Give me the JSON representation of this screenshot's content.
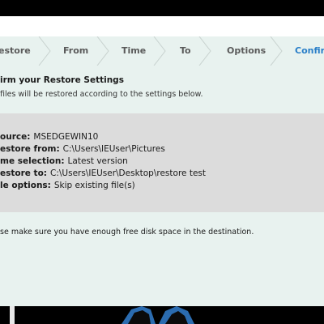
{
  "steps": [
    {
      "label": "estore",
      "active": false
    },
    {
      "label": "From",
      "active": false
    },
    {
      "label": "Time",
      "active": false
    },
    {
      "label": "To",
      "active": false
    },
    {
      "label": "Options",
      "active": false
    },
    {
      "label": "Confirm",
      "active": true
    }
  ],
  "heading": "irm your Restore Settings",
  "subheading": "files will be restored according to the settings below.",
  "settings": [
    {
      "key": "ource:",
      "value": "MSEDGEWIN10"
    },
    {
      "key": "estore from:",
      "value": "C:\\Users\\IEUser\\Pictures"
    },
    {
      "key": "me selection:",
      "value": "Latest version"
    },
    {
      "key": "estore to:",
      "value": "C:\\Users\\IEUser\\Desktop\\restore test"
    },
    {
      "key": "le options:",
      "value": "Skip existing file(s)"
    }
  ],
  "note": "se make sure you have enough free disk space in the destination.",
  "colors": {
    "panel_bg": "#e8f2ef",
    "settings_bg": "#dcdcdc",
    "active_step": "#2a7fc8",
    "step_text": "#5a5a5a"
  }
}
